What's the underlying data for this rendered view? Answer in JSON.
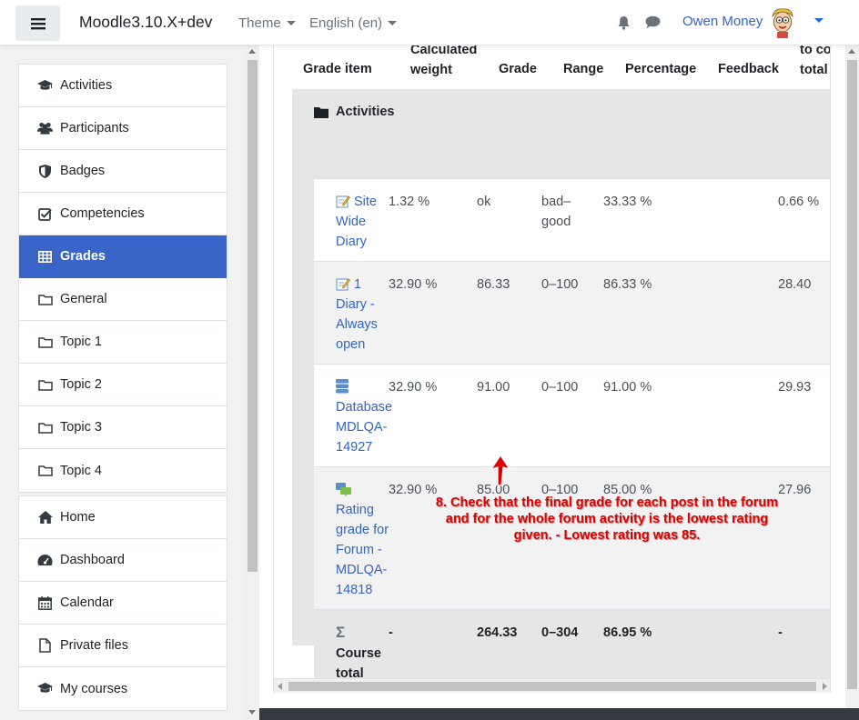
{
  "navbar": {
    "brand": "Moodle3.10.X+dev",
    "theme_menu": "Theme",
    "language_menu": "English (en)",
    "user_name": "Owen Money"
  },
  "sidebar": {
    "course_items": [
      {
        "label": "Activities",
        "icon": "graduation-cap-icon"
      },
      {
        "label": "Participants",
        "icon": "users-icon"
      },
      {
        "label": "Badges",
        "icon": "shield-icon"
      },
      {
        "label": "Competencies",
        "icon": "checkbox-icon"
      },
      {
        "label": "Grades",
        "icon": "table-icon",
        "active": true
      },
      {
        "label": "General",
        "icon": "folder-icon"
      },
      {
        "label": "Topic 1",
        "icon": "folder-icon"
      },
      {
        "label": "Topic 2",
        "icon": "folder-icon"
      },
      {
        "label": "Topic 3",
        "icon": "folder-icon"
      },
      {
        "label": "Topic 4",
        "icon": "folder-icon"
      }
    ],
    "site_items": [
      {
        "label": "Home",
        "icon": "home-icon"
      },
      {
        "label": "Dashboard",
        "icon": "dashboard-icon"
      },
      {
        "label": "Calendar",
        "icon": "calendar-icon"
      },
      {
        "label": "Private files",
        "icon": "file-icon"
      },
      {
        "label": "My courses",
        "icon": "graduation-cap-icon"
      }
    ]
  },
  "grades_table": {
    "headers": {
      "grade_item": "Grade item",
      "calculated_weight_1": "Calculated",
      "calculated_weight_2": "weight",
      "grade": "Grade",
      "range": "Range",
      "percentage": "Percentage",
      "feedback": "Feedback",
      "contribution_1": "to co",
      "contribution_2": "total"
    },
    "category": "Activities",
    "rows": [
      {
        "name_lines": [
          "Site",
          "Wide",
          "Diary"
        ],
        "weight": "1.32 %",
        "grade": "ok",
        "range_lines": [
          "bad–",
          "good"
        ],
        "percentage": "33.33 %",
        "feedback": "",
        "contribution": "0.66 %"
      },
      {
        "name_lines": [
          "1",
          "Diary -",
          "Always",
          "open"
        ],
        "weight": "32.90 %",
        "grade": "86.33",
        "range_lines": [
          "0–100"
        ],
        "percentage": "86.33 %",
        "feedback": "",
        "contribution": "28.40"
      },
      {
        "name_lines": [
          "Database",
          "MDLQA-",
          "14927"
        ],
        "weight": "32.90 %",
        "grade": "91.00",
        "range_lines": [
          "0–100"
        ],
        "percentage": "91.00 %",
        "feedback": "",
        "contribution": "29.93"
      },
      {
        "name_lines": [
          "Rating",
          "grade for",
          "Forum -",
          "MDLQA-",
          "14818"
        ],
        "weight": "32.90 %",
        "grade": "85.00",
        "range_lines": [
          "0–100"
        ],
        "percentage": "85.00 %",
        "feedback": "",
        "contribution": "27.96"
      }
    ],
    "total": {
      "symbol": "Σ",
      "label_1": "Course",
      "label_2": "total",
      "weight": "-",
      "grade": "264.33",
      "range": "0–304",
      "percentage": "86.95 %",
      "contribution": "-"
    }
  },
  "annotation": {
    "line1": "8. Check that the final grade for each post in the forum",
    "line2": "and for the whole forum activity is the lowest rating",
    "line3": "given. - Lowest rating was 85."
  },
  "colors": {
    "accent": "#3a65c8",
    "link": "#3264c8",
    "annotation": "#e00000"
  }
}
